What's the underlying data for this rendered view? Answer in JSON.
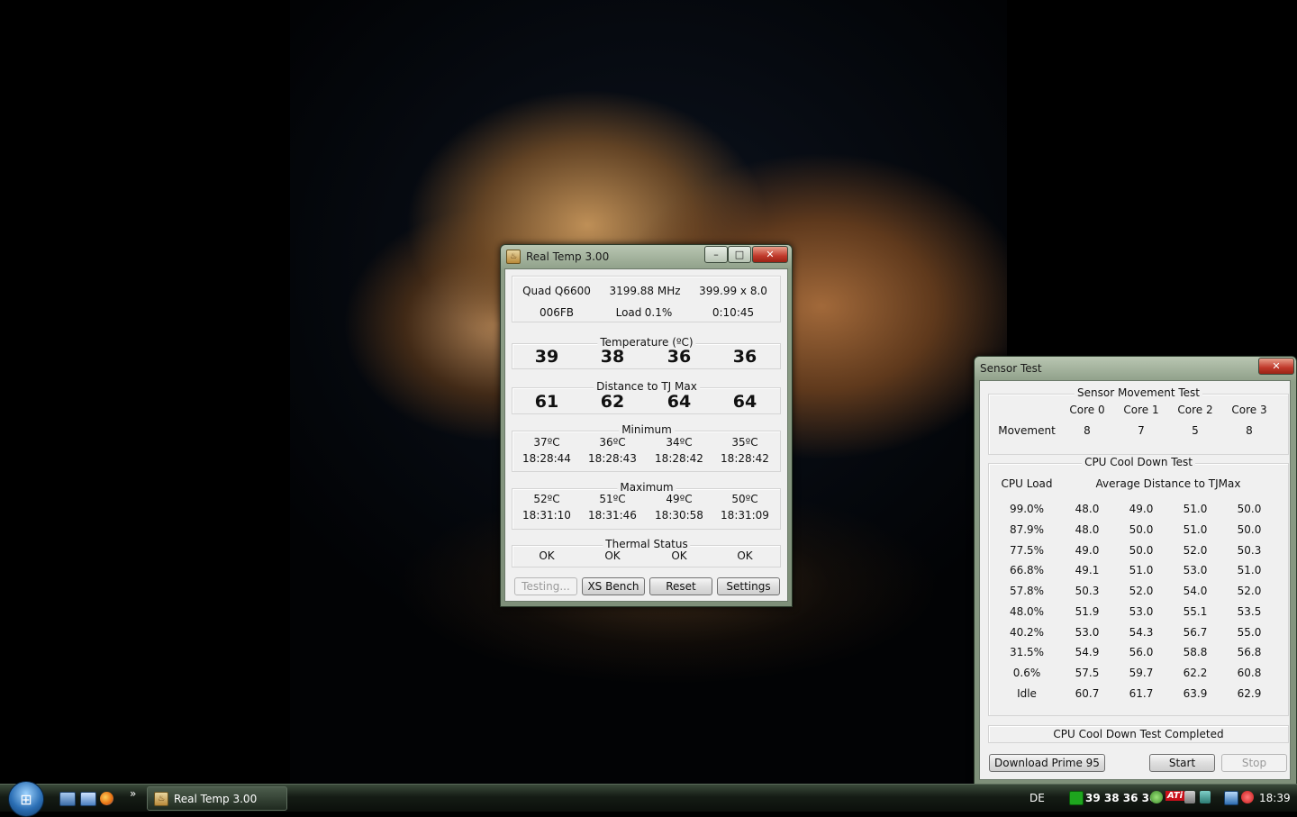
{
  "realtemp": {
    "title": "Real Temp 3.00",
    "cpu": {
      "model": "Quad Q6600",
      "clock": "3199.88 MHz",
      "multiplier": "399.99 x 8.0",
      "id": "006FB",
      "load_label": "Load",
      "load": "0.1%",
      "uptime": "0:10:45"
    },
    "temperature": {
      "label": "Temperature (ºC)",
      "values": [
        "39",
        "38",
        "36",
        "36"
      ]
    },
    "distance": {
      "label": "Distance to TJ Max",
      "values": [
        "61",
        "62",
        "64",
        "64"
      ]
    },
    "minimum": {
      "label": "Minimum",
      "temps": [
        "37ºC",
        "36ºC",
        "34ºC",
        "35ºC"
      ],
      "times": [
        "18:28:44",
        "18:28:43",
        "18:28:42",
        "18:28:42"
      ]
    },
    "maximum": {
      "label": "Maximum",
      "temps": [
        "52ºC",
        "51ºC",
        "49ºC",
        "50ºC"
      ],
      "times": [
        "18:31:10",
        "18:31:46",
        "18:30:58",
        "18:31:09"
      ]
    },
    "thermal": {
      "label": "Thermal Status",
      "values": [
        "OK",
        "OK",
        "OK",
        "OK"
      ]
    },
    "buttons": {
      "testing": "Testing...",
      "xs_bench": "XS Bench",
      "reset": "Reset",
      "settings": "Settings"
    }
  },
  "sensor": {
    "title": "Sensor Test",
    "movement": {
      "label": "Sensor Movement Test",
      "cores": [
        "Core 0",
        "Core 1",
        "Core 2",
        "Core 3"
      ],
      "row_label": "Movement",
      "values": [
        "8",
        "7",
        "5",
        "8"
      ]
    },
    "cooldown": {
      "label": "CPU Cool Down Test",
      "col_load": "CPU Load",
      "col_avg": "Average Distance to TJMax",
      "rows": [
        {
          "load": "99.0%",
          "values": [
            "48.0",
            "49.0",
            "51.0",
            "50.0"
          ]
        },
        {
          "load": "87.9%",
          "values": [
            "48.0",
            "50.0",
            "51.0",
            "50.0"
          ]
        },
        {
          "load": "77.5%",
          "values": [
            "49.0",
            "50.0",
            "52.0",
            "50.3"
          ]
        },
        {
          "load": "66.8%",
          "values": [
            "49.1",
            "51.0",
            "53.0",
            "51.0"
          ]
        },
        {
          "load": "57.8%",
          "values": [
            "50.3",
            "52.0",
            "54.0",
            "52.0"
          ]
        },
        {
          "load": "48.0%",
          "values": [
            "51.9",
            "53.0",
            "55.1",
            "53.5"
          ]
        },
        {
          "load": "40.2%",
          "values": [
            "53.0",
            "54.3",
            "56.7",
            "55.0"
          ]
        },
        {
          "load": "31.5%",
          "values": [
            "54.9",
            "56.0",
            "58.8",
            "56.8"
          ]
        },
        {
          "load": "0.6%",
          "values": [
            "57.5",
            "59.7",
            "62.2",
            "60.8"
          ]
        },
        {
          "load": "Idle",
          "values": [
            "60.7",
            "61.7",
            "63.9",
            "62.9"
          ]
        }
      ]
    },
    "status": "CPU Cool Down Test Completed",
    "buttons": {
      "download": "Download Prime 95",
      "start": "Start",
      "stop": "Stop"
    }
  },
  "taskbar": {
    "task_label": "Real Temp 3.00",
    "more": "»",
    "lang": "DE",
    "tray_temps": "39 38 36 36",
    "tray_ati": "ATi",
    "clock": "18:39"
  },
  "glyphs": {
    "minimize": "–",
    "maximize": "□",
    "close": "✕",
    "start": "⊞"
  }
}
